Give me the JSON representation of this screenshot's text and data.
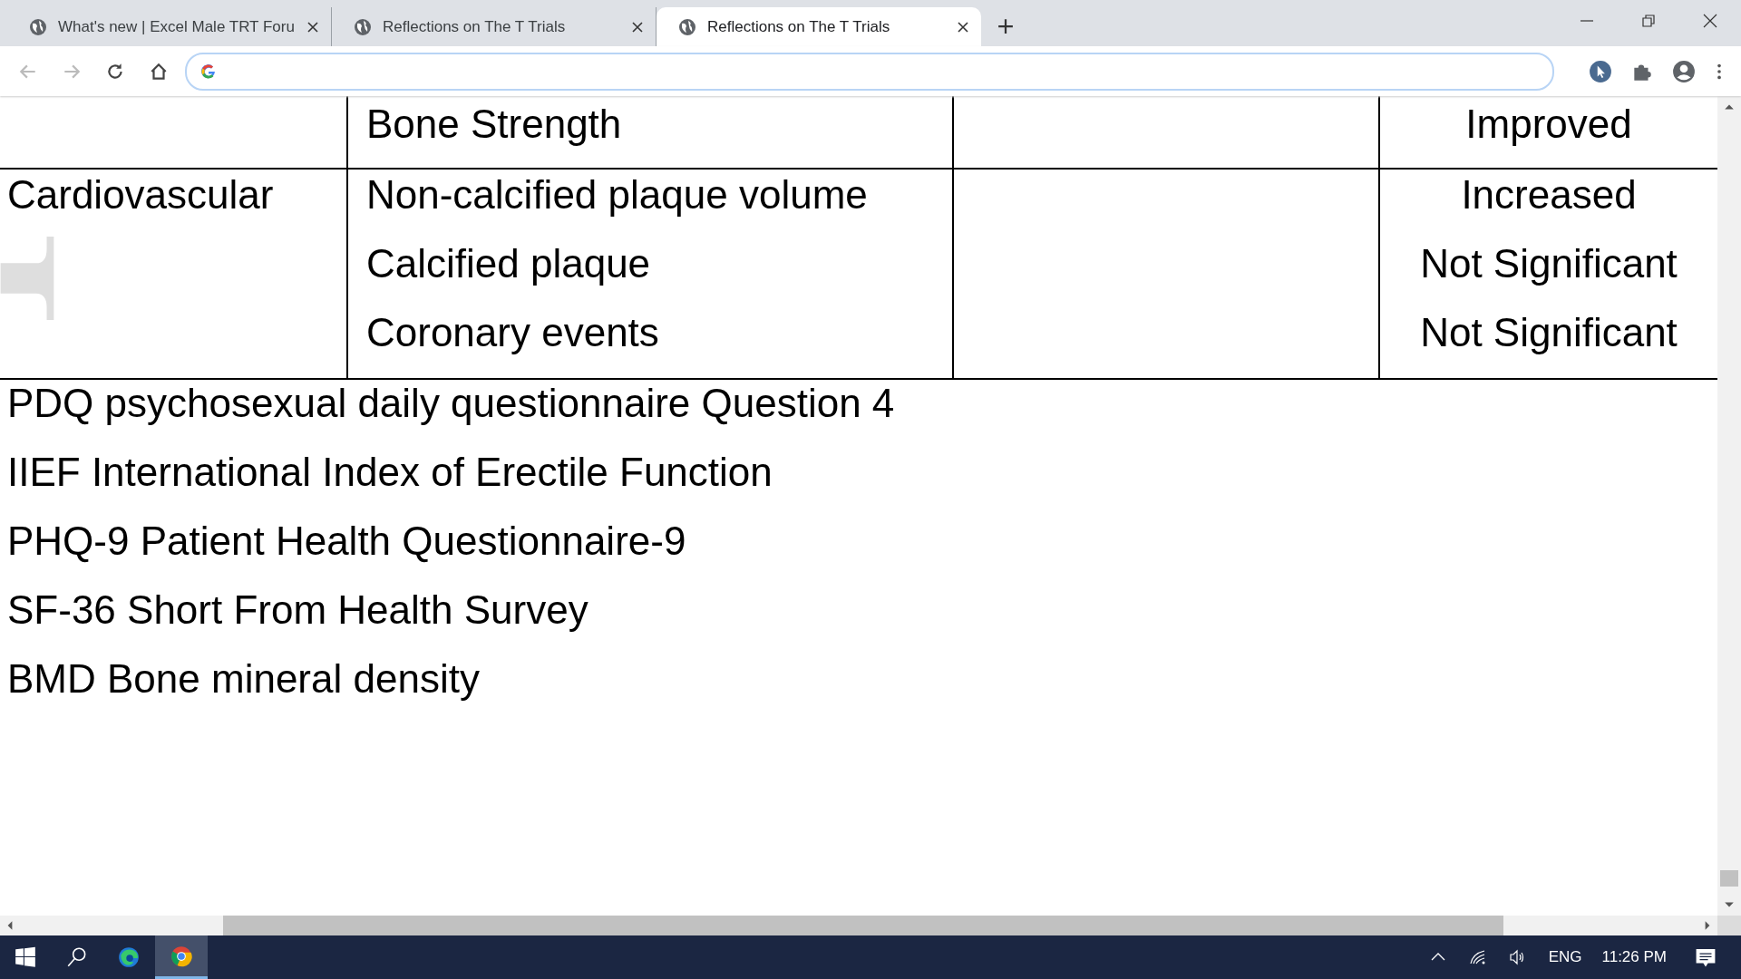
{
  "tabs": [
    {
      "title": "What's new | Excel Male TRT Foru",
      "selected": false
    },
    {
      "title": "Reflections on The T Trials",
      "selected": false
    },
    {
      "title": "Reflections on The T Trials",
      "selected": true
    }
  ],
  "table": {
    "rows": [
      {
        "measures": [
          {
            "name": "Bone Strength",
            "result": "Improved"
          }
        ]
      },
      {
        "category": "Cardiovascular",
        "measures": [
          {
            "name": "Non-calcified plaque volume",
            "result": "Increased"
          },
          {
            "name": "Calcified plaque",
            "result": "Not Significant"
          },
          {
            "name": "Coronary events",
            "result": "Not Significant"
          }
        ]
      }
    ]
  },
  "abbreviations": [
    "PDQ psychosexual daily questionnaire Question 4",
    "IIEF International Index of Erectile Function",
    "PHQ-9 Patient Health Questionnaire-9",
    "SF-36 Short From Health Survey",
    "BMD Bone mineral density"
  ],
  "taskbar": {
    "language": "ENG",
    "time": "11:26 PM"
  }
}
